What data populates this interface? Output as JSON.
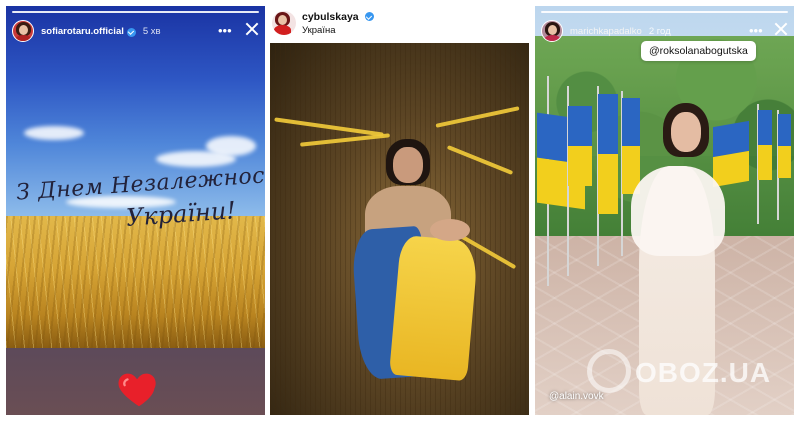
{
  "stories": [
    {
      "username": "sofiarotaru.official",
      "time": "5 хв",
      "greeting_line1": "З Днем Незалежності",
      "greeting_line2": "України!",
      "reaction": "heart"
    },
    {
      "username": "cybulskaya",
      "location": "Україна"
    },
    {
      "username": "marichkapadalko",
      "time": "2 год",
      "mention_tag": "@roksolanabogutska",
      "credit": "@alain.vovk"
    }
  ],
  "watermark": "OBOZ.UA",
  "colors": {
    "verified": "#3897f0",
    "ukraine_blue": "#2b66c2",
    "ukraine_yellow": "#f2cf1d"
  }
}
